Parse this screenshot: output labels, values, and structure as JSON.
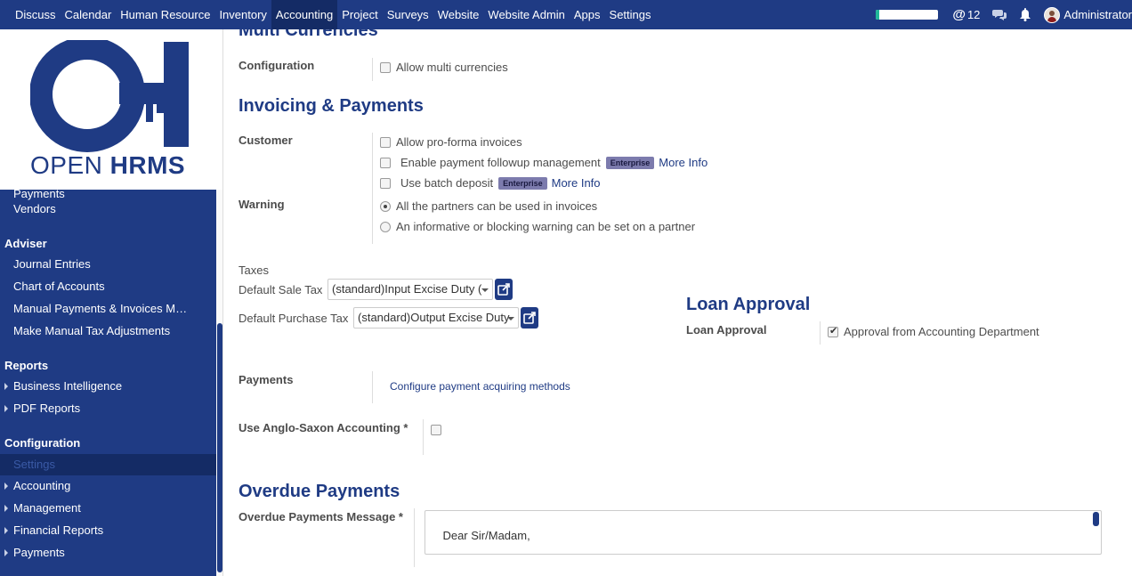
{
  "topbar": {
    "menu": [
      "Discuss",
      "Calendar",
      "Human Resource",
      "Inventory",
      "Accounting",
      "Project",
      "Surveys",
      "Website",
      "Website Admin",
      "Apps",
      "Settings"
    ],
    "active_menu": "Accounting",
    "progress_fraction": 0.05,
    "mentions_count": "12",
    "user_name": "Administrator"
  },
  "logo": {
    "light": "OPEN ",
    "bold": "HRMS"
  },
  "sidebar": {
    "partial_top": "Payments",
    "vendors": "Vendors",
    "adviser_header": "Adviser",
    "adviser_items": [
      "Journal Entries",
      "Chart of Accounts",
      "Manual Payments & Invoices Matching",
      "Make Manual Tax Adjustments"
    ],
    "reports_header": "Reports",
    "report_items": [
      "Business Intelligence",
      "PDF Reports"
    ],
    "config_header": "Configuration",
    "config_selected": "Settings",
    "config_items": [
      "Accounting",
      "Management",
      "Financial Reports",
      "Payments"
    ]
  },
  "multi_currencies": {
    "title": "Multi Currencies",
    "config_label": "Configuration",
    "allow_multi": "Allow multi currencies"
  },
  "invoicing": {
    "title": "Invoicing & Payments",
    "customer_label": "Customer",
    "proforma": "Allow pro-forma invoices",
    "followup": "Enable payment followup management",
    "batch": "Use batch deposit",
    "enterprise_badge": "Enterprise",
    "more_info": "More Info",
    "warning_label": "Warning",
    "warning_opt1": "All the partners can be used in invoices",
    "warning_opt2": "An informative or blocking warning can be set on a partner"
  },
  "taxes": {
    "title": "Taxes",
    "sale_label": "Default Sale Tax",
    "sale_value": "(standard)Input Excise Duty (",
    "purchase_label": "Default Purchase Tax",
    "purchase_value": "(standard)Output Excise Duty"
  },
  "loan": {
    "title": "Loan Approval",
    "label": "Loan Approval",
    "option": "Approval from Accounting Department"
  },
  "payments": {
    "label": "Payments",
    "link": "Configure payment acquiring methods"
  },
  "anglo": {
    "label": "Use Anglo-Saxon Accounting *"
  },
  "overdue": {
    "title": "Overdue Payments",
    "label": "Overdue Payments Message *",
    "message": "Dear Sir/Madam,\n\nOur records indicate that some payments on your account are still due. Please find details below."
  },
  "colors": {
    "brand": "#1f3b84",
    "active_menu": "#142b65",
    "progress": "#21b799",
    "enterprise": "#7c7bad"
  }
}
